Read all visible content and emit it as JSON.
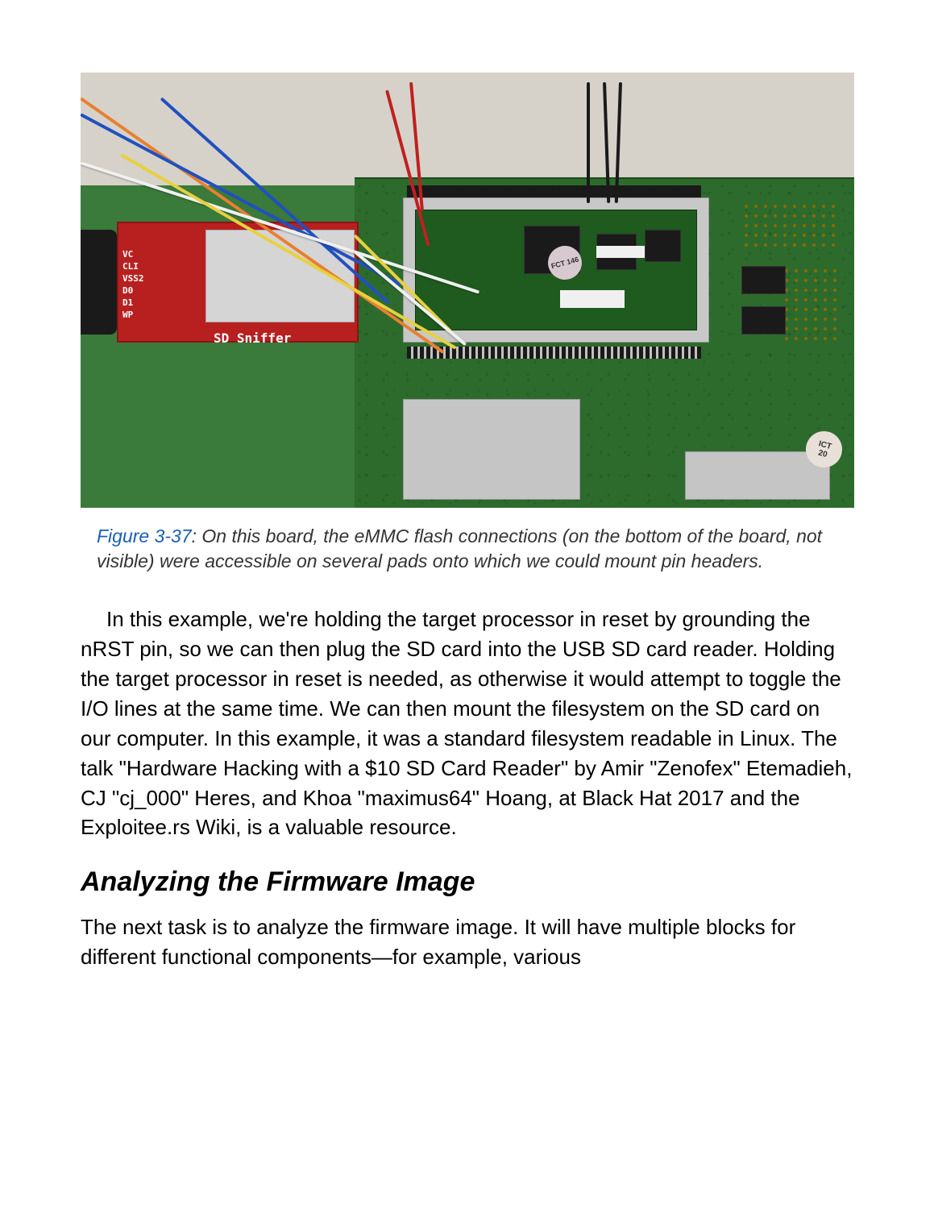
{
  "figure": {
    "reference": "Figure 3-37",
    "caption_text": ": On this board, the eMMC flash connections (on the bottom of the board, not visible) were accessible on several pads onto which we could mount pin headers.",
    "labels": {
      "sd_sniffer": "SD Sniffer",
      "pin_labels": "VC\nCLI\nVSS2\nD0\nD1\nWP",
      "sticker_round": "FCT 146",
      "ict_label_1": "ICT",
      "ict_label_2": "20"
    }
  },
  "paragraph1": "In this example, we're holding the target processor in reset by grounding the nRST pin, so we can then plug the SD card into the USB SD card reader. Holding the target processor in reset is needed, as otherwise it would attempt to toggle the I/O lines at the same time. We can then mount the filesystem on the SD card on our computer. In this example, it was a standard filesystem readable in Linux. The talk \"Hardware Hacking with a $10 SD Card Reader\" by Amir \"Zenofex\" Etemadieh, CJ \"cj_000\" Heres, and Khoa \"maximus64\" Hoang, at Black Hat 2017 and the Exploitee.rs Wiki, is a valuable resource.",
  "heading": "Analyzing the Firmware Image",
  "paragraph2": "The next task is to analyze the firmware image. It will have multiple blocks for different functional components—for example, various"
}
